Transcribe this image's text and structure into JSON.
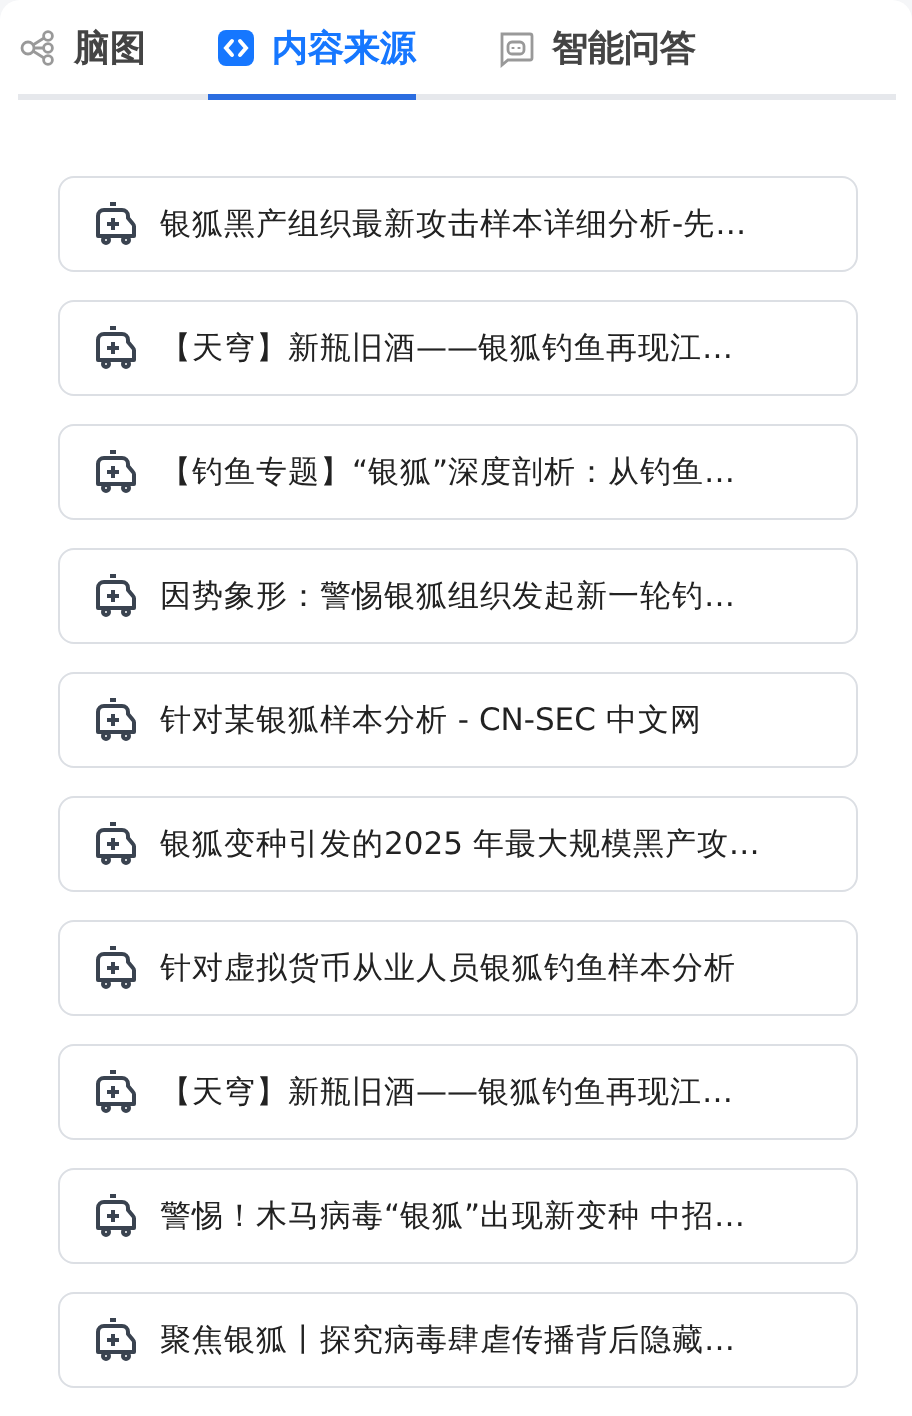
{
  "tabs": [
    {
      "label": "脑图",
      "selected": false
    },
    {
      "label": "内容来源",
      "selected": true
    },
    {
      "label": "智能问答",
      "selected": false
    }
  ],
  "sources": [
    {
      "title": "银狐黑产组织最新攻击样本详细分析-先…"
    },
    {
      "title": "【天穹】新瓶旧酒——银狐钓鱼再现江…"
    },
    {
      "title": "【钓鱼专题】“银狐”深度剖析：从钓鱼…"
    },
    {
      "title": "因势象形：警惕银狐组织发起新一轮钓…"
    },
    {
      "title": "针对某银狐样本分析 - CN-SEC 中文网"
    },
    {
      "title": "银狐变种引发的2025 年最大规模黑产攻…"
    },
    {
      "title": "针对虚拟货币从业人员银狐钓鱼样本分析"
    },
    {
      "title": "【天穹】新瓶旧酒——银狐钓鱼再现江…"
    },
    {
      "title": "警惕！木马病毒“银狐”出现新变种 中招…"
    },
    {
      "title": "聚焦银狐丨探究病毒肆虐传播背后隐藏…"
    }
  ]
}
